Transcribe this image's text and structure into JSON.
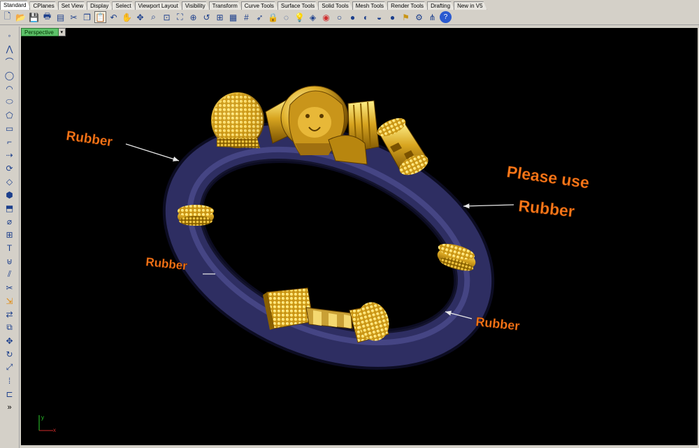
{
  "tabs": [
    "Standard",
    "CPlanes",
    "Set View",
    "Display",
    "Select",
    "Viewport Layout",
    "Visibility",
    "Transform",
    "Curve Tools",
    "Surface Tools",
    "Solid Tools",
    "Mesh Tools",
    "Render Tools",
    "Drafting",
    "New in V5"
  ],
  "active_tab_index": 0,
  "toolbar_icons": [
    "new-file-icon",
    "open-folder-icon",
    "save-icon",
    "print-icon",
    "properties-icon",
    "cut-icon",
    "copy-icon",
    "paste-icon",
    "undo-icon",
    "pan-hand-icon",
    "rotate-view-icon",
    "zoom-icon",
    "zoom-window-icon",
    "zoom-extents-icon",
    "zoom-selected-icon",
    "undo-view-icon",
    "four-viewports-icon",
    "construction-plane-icon",
    "grid-snap-icon",
    "select-objects-icon",
    "lock-icon",
    "hide-object-icon",
    "light-icon",
    "layer-icon",
    "color-wheel-icon",
    "wireframe-icon",
    "shaded-icon",
    "rendered-icon",
    "ghosted-icon",
    "sphere-render-icon",
    "render-icon",
    "gear-options-icon",
    "hierarchy-icon",
    "help-icon"
  ],
  "left_tools": [
    "point-icon",
    "polyline-icon",
    "curve-icon",
    "circle-icon",
    "arc-icon",
    "ellipse-icon",
    "polygon-icon",
    "rectangle-icon",
    "fillet-icon",
    "extend-icon",
    "offset-icon",
    "surface-corner-icon",
    "solid-box-icon",
    "extrude-icon",
    "pipe-icon",
    "mesh-icon",
    "text-icon",
    "boolean-union-icon",
    "split-icon",
    "trim-icon",
    "explode-icon",
    "join-icon",
    "group-icon",
    "move-icon",
    "rotate-icon",
    "scale-icon",
    "array-icon",
    "align-icon",
    "more-tools-icon"
  ],
  "viewport": {
    "name": "Perspective",
    "dropdown": "▾"
  },
  "annotations": [
    {
      "id": "left-top",
      "text": "Rubber"
    },
    {
      "id": "right",
      "line1": "Please use",
      "line2": "Rubber"
    },
    {
      "id": "left-bottom",
      "text": "Rubber"
    },
    {
      "id": "right-bottom",
      "text": "Rubber"
    }
  ],
  "axis": {
    "x": "x",
    "y": "y"
  },
  "colors": {
    "band": "#2a2a5a",
    "gold": "#d8a520",
    "annotation": "#ff7a1a",
    "viewport_bg": "#000000"
  }
}
